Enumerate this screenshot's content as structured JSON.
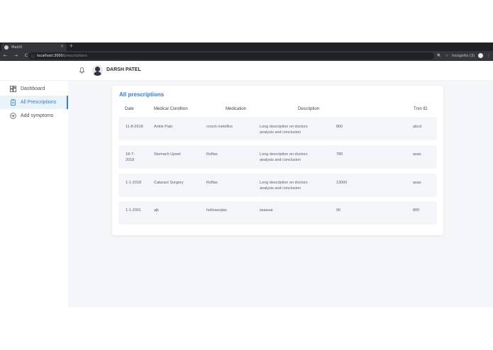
{
  "browser": {
    "tab_title": "MediX",
    "tab_close": "×",
    "new_tab": "+",
    "nav_icons": "← → C",
    "url_host": "localhost:3000",
    "url_path": "/prescriptions",
    "zoom_icon": "🔍",
    "star_icon": "☆",
    "incognito_label": "Incognito (3)",
    "menu_icon": "⋮"
  },
  "header": {
    "username": "DARSH PATEL"
  },
  "sidebar": {
    "items": [
      {
        "label": "Dashboard",
        "icon": "dashboard-icon"
      },
      {
        "label": "All Prescriptions",
        "icon": "clipboard-icon"
      },
      {
        "label": "Add symptoms",
        "icon": "plus-circle-icon"
      }
    ]
  },
  "main": {
    "title": "All prescriptions",
    "columns": [
      "Date",
      "Medical Condition",
      "Medication",
      "Description",
      "Trxn ID"
    ],
    "rows": [
      {
        "date": "11-8-2018",
        "condition": "Ankle Pain",
        "medication": "crocin  metoflox",
        "description": "Long description on doctors analysis and conclusion",
        "amount": "800",
        "trxn": "abcd"
      },
      {
        "date": "18-7-2018",
        "condition": "Stomach Upset",
        "medication": "Roflax",
        "description": "Long description on doctors analysis and conclusion",
        "amount": "780",
        "trxn": "asas"
      },
      {
        "date": "1-1-2018",
        "condition": "Cataract Surgery",
        "medication": "Roflax",
        "description": "Long description on doctors analysis and conclusion",
        "amount": "13000",
        "trxn": "asas"
      },
      {
        "date": "1-1-2001",
        "condition": "ajk",
        "medication": "helloasojias",
        "description": "iaiaasai",
        "amount": "90",
        "trxn": "800"
      }
    ]
  },
  "colors": {
    "accent": "#2f7fd6",
    "background": "#f5f6f9",
    "row_bg": "#f3f5f9"
  }
}
